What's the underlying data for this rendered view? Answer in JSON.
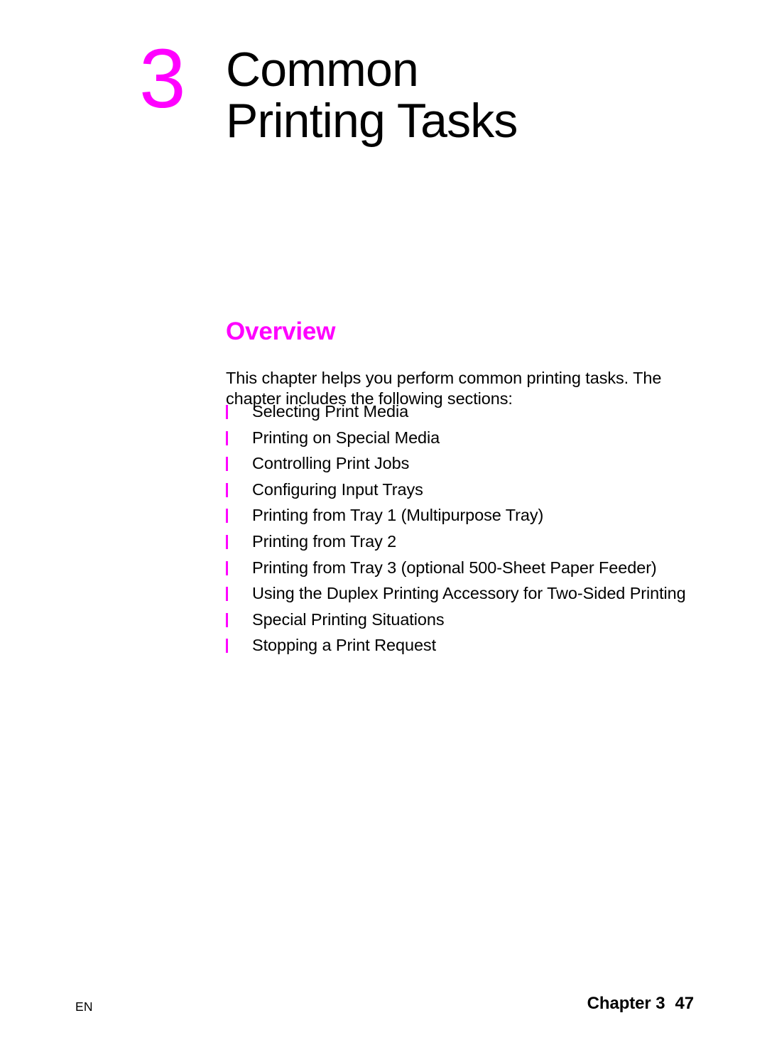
{
  "page": {
    "background_color": "#ffffff",
    "accent_color": "#ff00ff",
    "text_color": "#000000"
  },
  "chapter": {
    "number": "3",
    "title_line_1": "Common",
    "title_line_2": "Printing Tasks"
  },
  "section": {
    "heading": "Overview",
    "intro_line_1": "This chapter helps you perform common printing tasks. The",
    "intro_line_2": "chapter includes the following sections:",
    "items": [
      {
        "label": "Selecting Print Media"
      },
      {
        "label": "Printing on Special Media"
      },
      {
        "label": "Controlling Print Jobs"
      },
      {
        "label": "Configuring Input Trays"
      },
      {
        "label": "Printing from Tray 1 (Multipurpose Tray)"
      },
      {
        "label": "Printing from Tray 2"
      },
      {
        "label": "Printing from Tray 3 (optional 500-Sheet Paper Feeder)"
      },
      {
        "label": "Using the Duplex Printing Accessory for Two-Sided Printing"
      },
      {
        "label": "Special Printing Situations"
      },
      {
        "label": "Stopping a Print Request"
      }
    ]
  },
  "footer": {
    "language": "EN",
    "chapter_label": "Chapter 3",
    "page_number": "47"
  }
}
